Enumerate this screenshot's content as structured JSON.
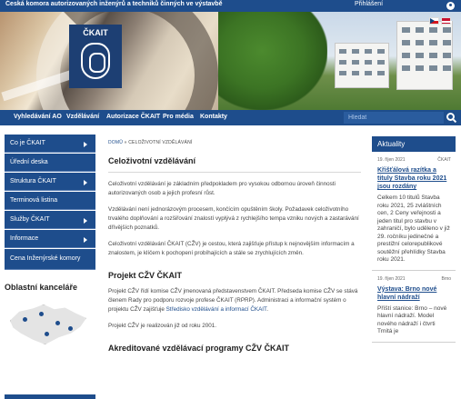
{
  "topbar": {
    "org_name": "Česká komora autorizovaných inženýrů a techniků činných ve výstavbě",
    "login_label": "Přihlášení"
  },
  "hero": {
    "logo_text": "ČKAIT"
  },
  "nav": {
    "items": [
      "Vyhledávání AO",
      "Vzdělávání",
      "Autorizace ČKAIT",
      "Pro média",
      "Kontakty"
    ],
    "search_placeholder": "Hledat"
  },
  "sidebar": {
    "items": [
      {
        "label": "Co je ČKAIT",
        "arrow": true
      },
      {
        "label": "Úřední deska",
        "arrow": false
      },
      {
        "label": "Struktura ČKAIT",
        "arrow": true
      },
      {
        "label": "Terminová listina",
        "arrow": false
      },
      {
        "label": "Služby ČKAIT",
        "arrow": true
      },
      {
        "label": "Informace",
        "arrow": true
      },
      {
        "label": "Cena Inženýrské komory",
        "arrow": false
      }
    ],
    "regions_title": "Oblastní kanceláře"
  },
  "content": {
    "breadcrumb_home": "DOMŮ",
    "breadcrumb_sep": "»",
    "breadcrumb_current": "CELOŽIVOTNÍ VZDĚLÁVÁNÍ",
    "title": "Celoživotní vzdělávání",
    "p1": "Celoživotní vzdělávání je základním předpokladem pro vysokou odbornou úroveň činnosti autorizovaných osob a jejich profesní růst.",
    "p2": "Vzdělávání není jednorázovým procesem, končícím opuštěním školy. Požadavek celoživotního trvalého doplňování a rozšiřování znalostí vyplývá z rychlejšího tempa vzniku nových a zastarávání dřívějších poznatků.",
    "p3": "Celoživotní vzdělávání ČKAIT (CŽV) je cestou, která zajišťuje přístup k nejnovějším informacím a znalostem, je klíčem k pochopení probíhajících a stále se zrychlujících změn.",
    "h2_project": "Projekt CŽV ČKAIT",
    "p4_start": "Projekt CŽV řídí komise CŽV jmenovaná představenstvem ČKAIT. Předseda komise CŽV se stává členem Rady pro podporu rozvoje profese ČKAIT (RPRP). Administraci a informační systém o projektu CŽV zajišťuje ",
    "p4_link": "Středisko vzdělávání a informací ČKAIT",
    "p4_end": ".",
    "p5": "Projekt CŽV je realizován již od roku 2001.",
    "h2_programs": "Akreditované vzdělávací programy CŽV ČKAIT"
  },
  "news": {
    "heading": "Aktuality",
    "items": [
      {
        "date": "19. říjen 2021",
        "tag": "ČKAIT",
        "title": "Křišťálová razítka a tituly Stavba roku 2021 jsou rozdány",
        "text": "Celkem 10 titulů Stavba roku 2021, 25 zvláštních cen, 2 Ceny veřejnosti a jeden titul pro stavbu v zahraničí, bylo uděleno v již 29. ročníku jedinečné a prestižní celorepublikové soutěžní přehlídky Stavba roku 2021."
      },
      {
        "date": "19. říjen 2021",
        "tag": "Brno",
        "title": "Výstava: Brno nové hlavní nádraží",
        "text": "Příští stanice: Brno – nové hlavní nádraží. Model nového nádraží i čtvrti Trnitá je"
      }
    ]
  }
}
